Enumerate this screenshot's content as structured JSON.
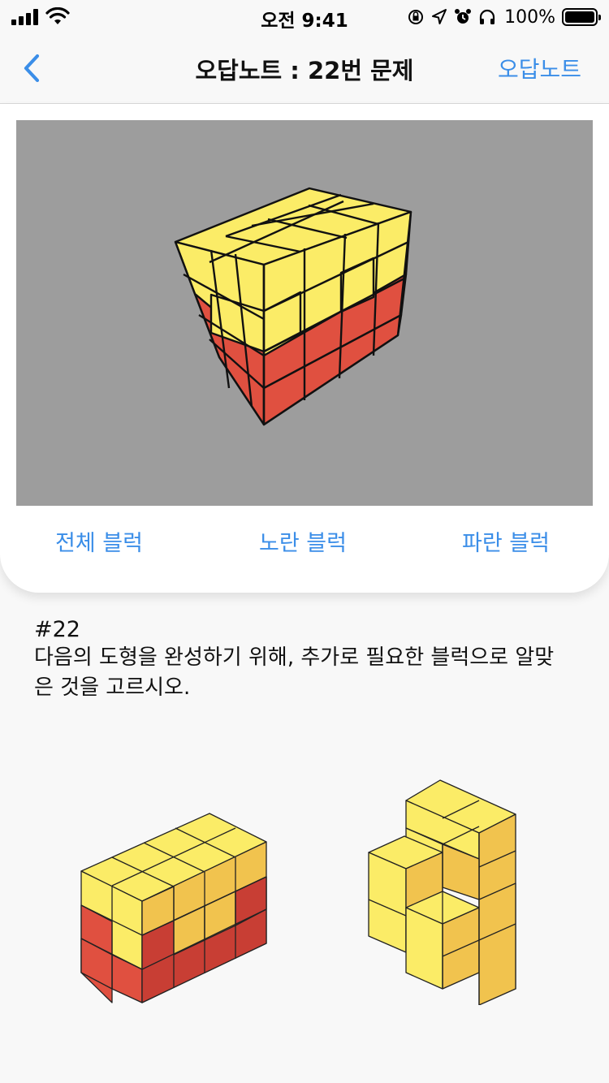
{
  "status_bar": {
    "time": "오전 9:41",
    "battery": "100%"
  },
  "nav": {
    "title": "오답노트 : 22번 문제",
    "right_label": "오답노트",
    "back_icon": "chevron-left-icon"
  },
  "viewer": {
    "background": "#9d9d9d",
    "colors": {
      "yellow": "#fbec67",
      "red": "#e05040"
    }
  },
  "tabs": [
    {
      "label": "전체 블럭"
    },
    {
      "label": "노란 블럭"
    },
    {
      "label": "파란 블럭"
    }
  ],
  "question": {
    "number": "#22",
    "text": "다음의 도형을 완성하기 위해, 추가로 필요한 블럭으로 알맞\n은 것을 고르시오."
  },
  "colors": {
    "accent": "#3b8ee8",
    "cube_yellow": "#fbec67",
    "cube_red": "#e05040"
  }
}
